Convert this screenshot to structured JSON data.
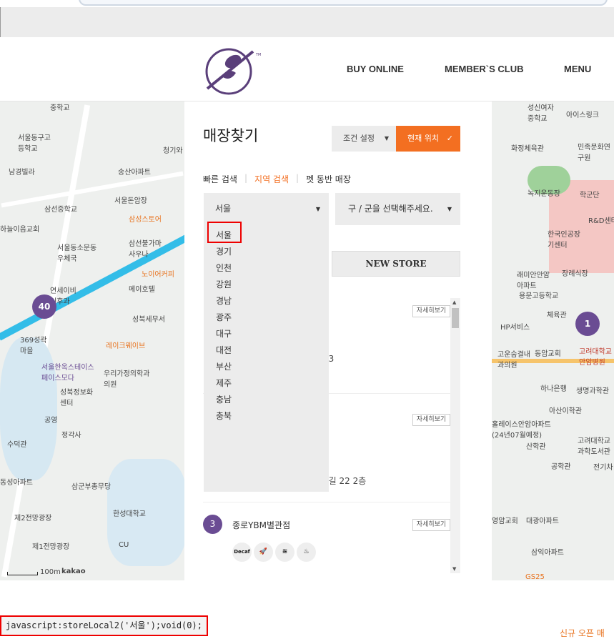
{
  "header": {
    "nav": [
      "BUY ONLINE",
      "MEMBER`S CLUB",
      "MENU"
    ]
  },
  "colors": {
    "accent": "#f36f21",
    "brand": "#6a4c93"
  },
  "panel": {
    "title": "매장찾기",
    "condition_label": "조건 설정",
    "current_location_label": "현재 위치",
    "tabs": [
      "빠른 검색",
      "지역 검색",
      "펫 동반 매장"
    ],
    "active_tab": "지역 검색",
    "city_select": "서울",
    "district_select": "구 / 군을 선택해주세요.",
    "new_store_label": "NEW STORE",
    "dropdown_options": [
      "서울",
      "경기",
      "인천",
      "강원",
      "경남",
      "광주",
      "대구",
      "대전",
      "부산",
      "제주",
      "충남",
      "충북"
    ],
    "highlighted_option": "서울",
    "stores": [
      {
        "detail": "자세히보기",
        "addr_fragment": "73"
      },
      {
        "detail": "자세히보기",
        "addr_fragment": "7길 22 2층"
      },
      {
        "num": "3",
        "name": "종로YBM별관점",
        "detail": "자세히보기",
        "amenities": [
          "Decaf",
          "rocket-icon",
          "wifi-icon",
          "cake-icon"
        ]
      }
    ]
  },
  "map_left": {
    "pin": "40",
    "labels": [
      "중학교",
      "서울동구고등학교",
      "남경빌라",
      "송산아파트",
      "청기와",
      "서울돈암장",
      "삼선중학교",
      "삼성스토어",
      "하늘이음교회",
      "서울동소문동우체국",
      "삼선불가마사우나",
      "노이어커피",
      "메이호텔",
      "연세이비인후과",
      "성북세무서",
      "369성곽마을",
      "레이크웨이브",
      "서울한옥스테이스페이스모다",
      "우리가정의학과의원",
      "성북정보화센터",
      "공영",
      "정각사",
      "수덕관",
      "동성아파트",
      "삼군부총무당",
      "한성대학교",
      "제2전망광장",
      "제1전망광장",
      "CU",
      "100m",
      "kakao"
    ]
  },
  "map_right": {
    "pin": "1",
    "labels": [
      "성신여자중학교",
      "아이스링크",
      "화정체육관",
      "민족문화연구원",
      "녹지운동장",
      "학군단",
      "R&D센터",
      "한국인공장기센터",
      "래미안안암아파트",
      "장례식장",
      "용문고등학교",
      "체육관",
      "HP서비스",
      "고운숨결내과의원",
      "동암교회",
      "고려대학교안암병원",
      "하나은행",
      "생명과학관",
      "아산이학관",
      "홀레이스안암아파트(24년07월예정)",
      "산학관",
      "고려대학교과학도서관",
      "공학관",
      "전기차",
      "영암교회",
      "대광아파트",
      "삼익아파트",
      "GS25"
    ]
  },
  "status_bar": "javascript:storeLocal2('서울');void(0);",
  "footer_fragment": "신규 오픈 매"
}
